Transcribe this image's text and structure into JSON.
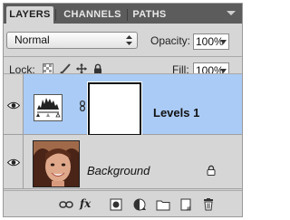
{
  "tabs": [
    {
      "label": "LAYERS",
      "active": true
    },
    {
      "label": "CHANNELS",
      "active": false
    },
    {
      "label": "PATHS",
      "active": false
    }
  ],
  "blend_mode": {
    "value": "Normal"
  },
  "opacity": {
    "label": "Opacity:",
    "value": "100%"
  },
  "lock": {
    "label": "Lock:"
  },
  "fill": {
    "label": "Fill:",
    "value": "100%"
  },
  "layers": [
    {
      "name": "Levels 1",
      "kind": "adjustment-levels",
      "selected": true,
      "visible": true,
      "has_mask": true
    },
    {
      "name": "Background",
      "kind": "pixel",
      "selected": false,
      "visible": true,
      "locked": true
    }
  ],
  "bottom_toolbar": [
    "link-layers-icon",
    "fx-icon",
    "add-mask-icon",
    "adjustment-layer-icon",
    "new-group-icon",
    "new-layer-icon",
    "trash-icon"
  ],
  "bottom_fx_label": "fx",
  "colors": {
    "selection": "#aacbf5",
    "panel": "#d6d6d6",
    "tab_bar": "#5c5c5c"
  }
}
